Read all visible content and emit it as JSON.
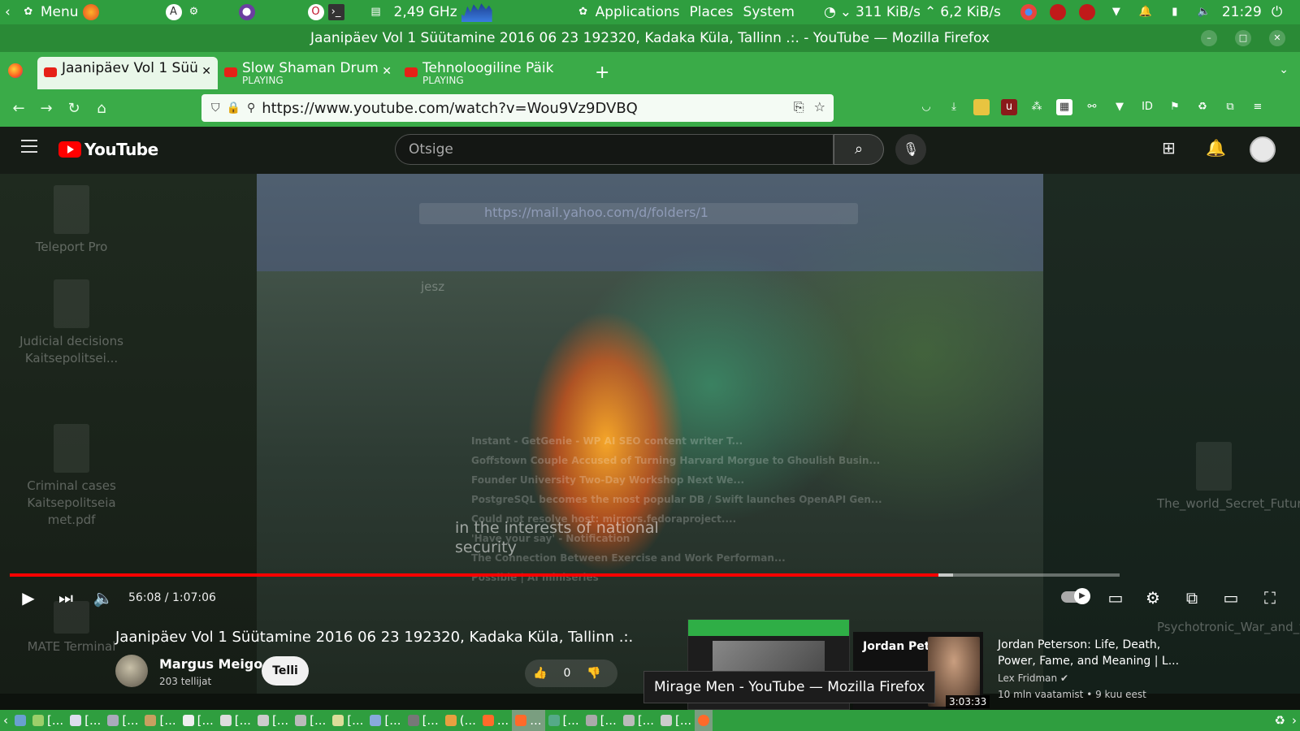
{
  "top_panel": {
    "menu_label": "Menu",
    "cpu_freq": "2,49 GHz",
    "applications": "Applications",
    "places": "Places",
    "system": "System",
    "net_down": "311 KiB/s",
    "net_up": "6,2 KiB/s",
    "clock": "21:29"
  },
  "window": {
    "title": "Jaanipäev Vol 1 Süütamine 2016 06 23 192320, Kadaka Küla, Tallinn .:. - YouTube — Mozilla Firefox"
  },
  "tabs": [
    {
      "label": "Jaanipäev Vol 1 Süü",
      "sub": "",
      "active": true
    },
    {
      "label": "Slow Shaman Drum",
      "sub": "PLAYING",
      "active": false
    },
    {
      "label": "Tehnoloogiline Päik",
      "sub": "PLAYING",
      "active": false
    }
  ],
  "urlbar": {
    "url": "https://www.youtube.com/watch?v=Wou9Vz9DVBQ"
  },
  "youtube": {
    "logo_text": "YouTube",
    "search_placeholder": "Otsige",
    "player": {
      "time": "56:08 / 1:07:06",
      "progress": 0.837,
      "loaded": 0.85
    },
    "caption": [
      "in the interests of national",
      "security"
    ],
    "video_title": "Jaanipäev Vol 1 Süütamine 2016 06 23 192320, Kadaka Küla, Tallinn .:.",
    "channel": "Margus Meigo",
    "subscribers": "203 tellijat",
    "subscribe_label": "Telli",
    "likes": "0",
    "recommendation": {
      "thumb_name": "Jordan Peterson",
      "duration": "3:03:33",
      "title": "Jordan Peterson: Life, Death, Power, Fame, and Meaning | L...",
      "channel": "Lex Fridman",
      "meta": "10 mln vaatamist • 9 kuu eest"
    },
    "tooltip": "Mirage Men - YouTube — Mozilla Firefox"
  },
  "ghost_layer": {
    "mail_url": "https://mail.yahoo.com/d/folders/1",
    "search_ghost": "jesz",
    "rows": [
      "Instant - GetGenie - WP AI SEO content writer T...",
      "Goffstown Couple Accused of Turning Harvard Morgue to Ghoulish Busin...",
      "Founder University Two-Day Workshop Next We...",
      "PostgreSQL becomes the most popular DB / Swift launches OpenAPI Gen...",
      "Could not resolve host: mirrors.fedoraproject....",
      "'Have your say' - Notification",
      "The Connection Between Exercise and Work Performan...",
      "Possible | AI miniseries"
    ],
    "files_left": [
      "Teleport Pro",
      "Judicial decisions Kaitsepolitsei...",
      "Criminal cases Kaitsepolitseia met.pdf",
      "MATE Terminal"
    ],
    "files_right": [
      "The_world_Secret_Future_Wars_in_Present",
      "Psychotronic_War_and_the_Security_of_Russia.pdf"
    ]
  },
  "taskbar": {
    "items": [
      "[...",
      "[...",
      "[...",
      "[...",
      "[...",
      "[...",
      "[...",
      "[...",
      "[...",
      "[...",
      "[...",
      "(...",
      "...",
      "...",
      "[...",
      "[...",
      "[...",
      "[..."
    ]
  },
  "colors": {
    "panel_green": "#2f9e3f",
    "browser_green": "#3aab48",
    "youtube_red": "#ff0000"
  }
}
